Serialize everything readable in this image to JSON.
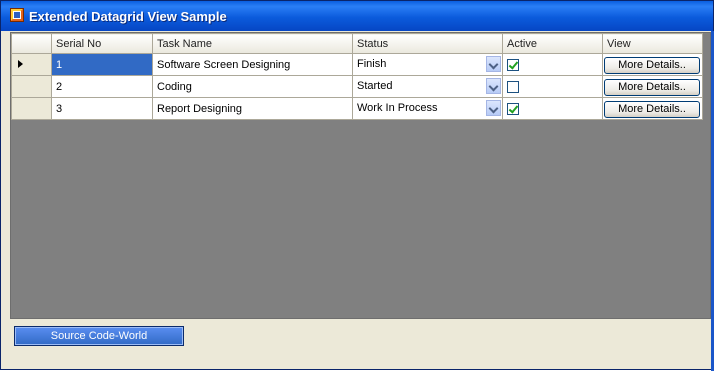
{
  "window": {
    "title": "Extended Datagrid View Sample"
  },
  "grid": {
    "columns": [
      "Serial No",
      "Task Name",
      "Status",
      "Active",
      "View"
    ],
    "rows": [
      {
        "serial": "1",
        "task": "Software Screen Designing",
        "status": "Finish",
        "active": true,
        "view_label": "More Details.."
      },
      {
        "serial": "2",
        "task": "Coding",
        "status": "Started",
        "active": false,
        "view_label": "More Details.."
      },
      {
        "serial": "3",
        "task": "Report Designing",
        "status": "Work In Process",
        "active": true,
        "view_label": "More Details.."
      }
    ]
  },
  "footer": {
    "button_label": "Source Code-World"
  },
  "colors": {
    "title_bar": "#0b5bdc",
    "selection": "#316ac5",
    "grid_background": "#808080",
    "window_background": "#ece9d8"
  }
}
